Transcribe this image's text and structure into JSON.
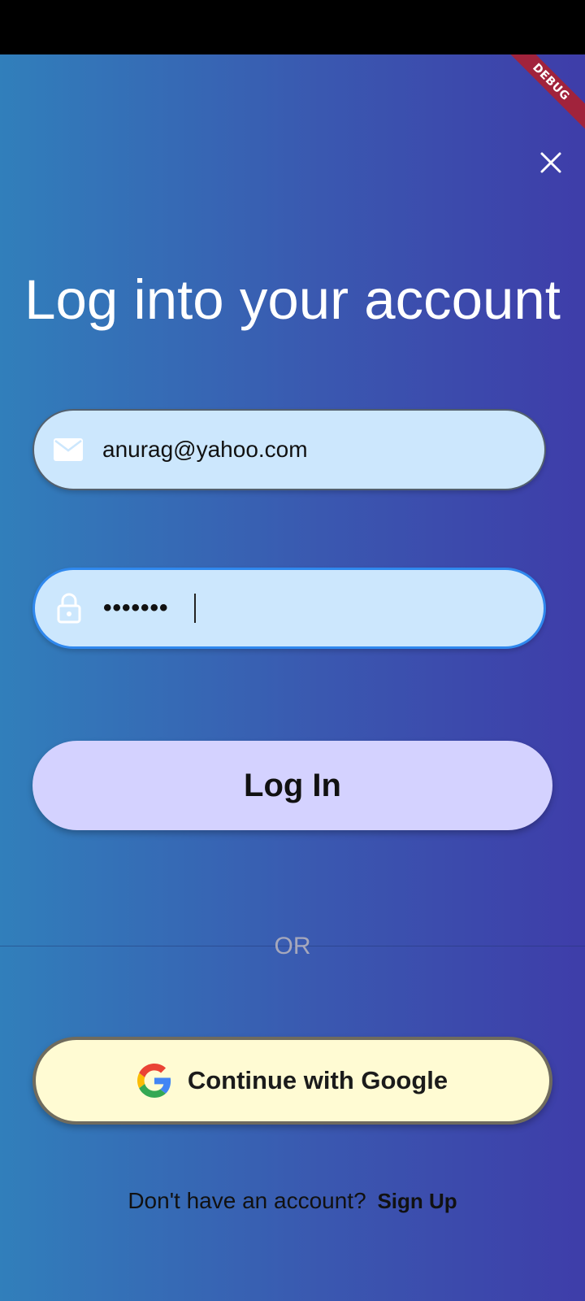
{
  "debug_banner": "DEBUG",
  "title": "Log into your account",
  "email": {
    "value": "anurag@yahoo.com",
    "icon": "mail-icon"
  },
  "password": {
    "value": "•••••••",
    "icon": "lock-icon"
  },
  "login_label": "Log In",
  "or_text": "OR",
  "google_label": "Continue with Google",
  "signup": {
    "prompt": "Don't have an account?",
    "link": "Sign Up"
  },
  "colors": {
    "gradient_start": "#317fbb",
    "gradient_end": "#3e3da9",
    "field_bg": "#cce7fd",
    "focus_border": "#2f88ee",
    "login_bg": "#d4d2ff",
    "google_bg": "#fffbd3",
    "debug_banner": "#a1233c"
  }
}
